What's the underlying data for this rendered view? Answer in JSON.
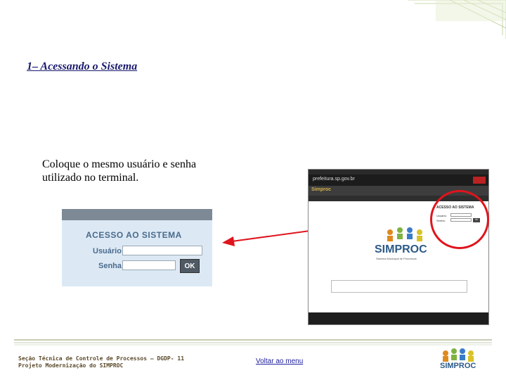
{
  "slide": {
    "title": "1– Acessando o Sistema",
    "instruction": "Coloque o mesmo usuário e senha utilizado no terminal."
  },
  "login_zoom": {
    "heading": "ACESSO AO SISTEMA",
    "user_label": "Usuário:",
    "password_label": "Senha:",
    "ok_label": "OK"
  },
  "site_screenshot": {
    "domain": "prefeitura.sp.gov.br",
    "brand": "Simproc",
    "login_heading": "ACESSO AO SISTEMA",
    "user_label": "Usuário:",
    "password_label": "Senha:",
    "ok_label": "OK",
    "logo_text": "SIMPROC",
    "logo_subtitle": "Sistema Municipal de Processos"
  },
  "footer": {
    "line1": "Seção Técnica de Controle de Processos – DGDP- 11",
    "line2": "Projeto Modernização do SIMPROC",
    "back_link": "Voltar ao menu",
    "logo_text": "SIMPROC"
  },
  "colors": {
    "title": "#1a1a6e",
    "highlight": "#e0141c",
    "login_panel": "#dce9f5",
    "footer_text": "#5b4a2a"
  }
}
